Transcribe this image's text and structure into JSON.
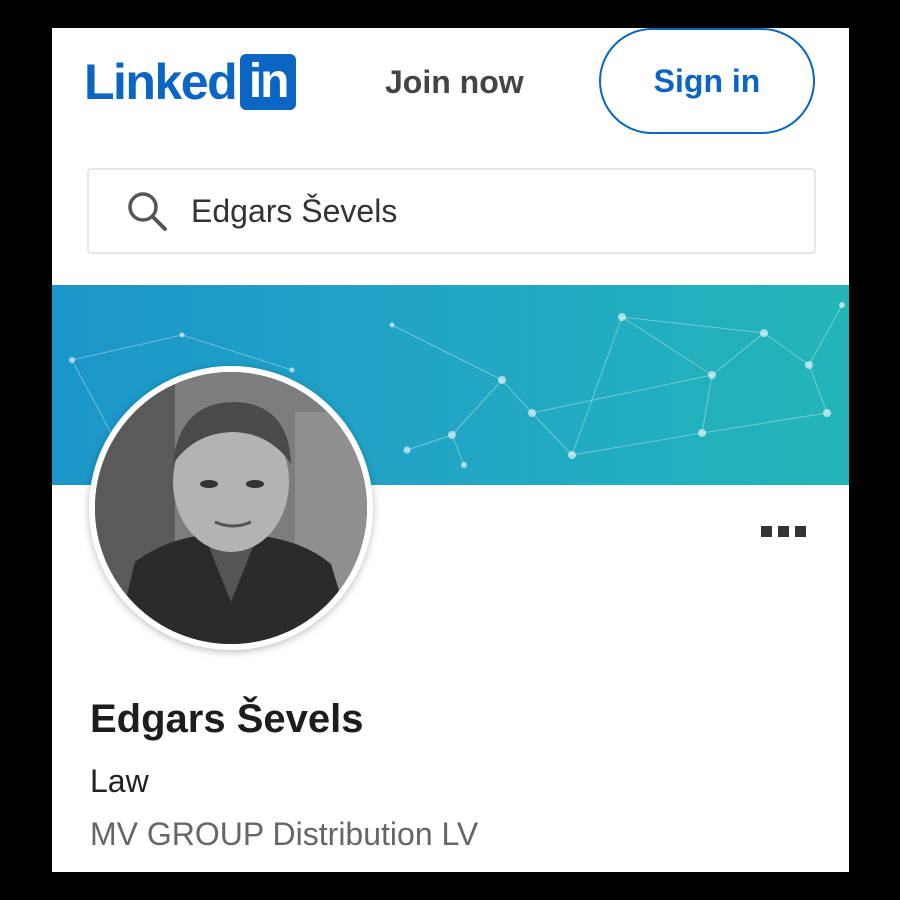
{
  "header": {
    "logo_text": "Linked",
    "logo_box_text": "in",
    "join_label": "Join now",
    "signin_label": "Sign in"
  },
  "search": {
    "value": "Edgars Ševels",
    "icon": "search-icon"
  },
  "profile": {
    "name": "Edgars Ševels",
    "headline": "Law",
    "company": "MV GROUP Distribution LV",
    "more_icon": "more-icon"
  },
  "colors": {
    "brand": "#0a66c2",
    "banner_start": "#1a96c9",
    "banner_end": "#23b4b8"
  }
}
